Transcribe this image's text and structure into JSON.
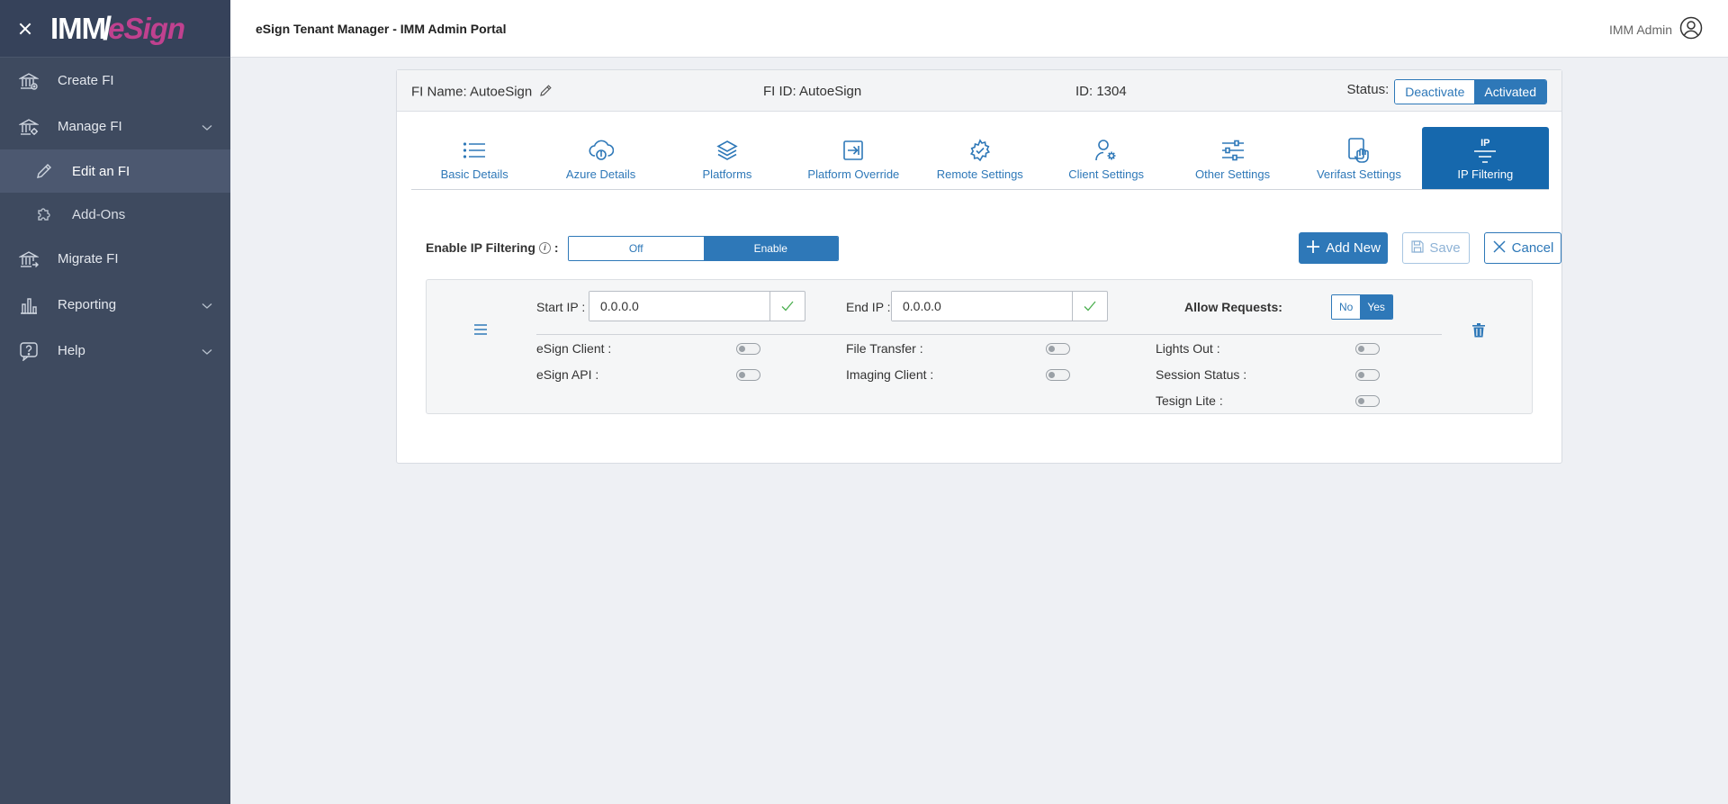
{
  "sidebar": {
    "logo_imm": "IMM",
    "logo_esign": "eSign",
    "items": [
      {
        "label": "Create FI"
      },
      {
        "label": "Manage FI"
      },
      {
        "label": "Edit an FI"
      },
      {
        "label": "Add-Ons"
      },
      {
        "label": "Migrate FI"
      },
      {
        "label": "Reporting"
      },
      {
        "label": "Help"
      }
    ]
  },
  "topbar": {
    "title": "eSign Tenant Manager - IMM Admin Portal",
    "user": "IMM Admin"
  },
  "card": {
    "fi_name": "FI Name: AutoeSign",
    "fi_id": "FI ID: AutoeSign",
    "id": "ID: 1304",
    "status_label": "Status:",
    "status_options": [
      "Deactivate",
      "Activated"
    ],
    "status_selected": "Activated"
  },
  "tabs": [
    {
      "label": "Basic Details",
      "icon": "list-icon"
    },
    {
      "label": "Azure Details",
      "icon": "cloud-icon"
    },
    {
      "label": "Platforms",
      "icon": "layers-icon"
    },
    {
      "label": "Platform Override",
      "icon": "override-icon"
    },
    {
      "label": "Remote Settings",
      "icon": "gear-icon"
    },
    {
      "label": "Client Settings",
      "icon": "user-gear-icon"
    },
    {
      "label": "Other Settings",
      "icon": "sliders-icon"
    },
    {
      "label": "Verifast Settings",
      "icon": "hand-icon"
    },
    {
      "label": "IP Filtering",
      "icon": "ip-filter-icon",
      "icon_text": "IP",
      "active": true
    }
  ],
  "ip_filtering": {
    "label": "Enable IP Filtering",
    "info_glyph": "i",
    "colon": ":",
    "options": [
      "Off",
      "Enable"
    ],
    "selected": "Enable",
    "add_label": "Add New",
    "save_label": "Save",
    "cancel_label": "Cancel"
  },
  "rule": {
    "start_label": "Start IP :",
    "start_value": "0.0.0.0",
    "end_label": "End IP :",
    "end_value": "0.0.0.0",
    "allow_label": "Allow Requests:",
    "allow_options": [
      "No",
      "Yes"
    ],
    "allow_selected": "Yes",
    "services": [
      {
        "label": "eSign Client :",
        "on": false
      },
      {
        "label": "eSign API :",
        "on": false
      },
      {
        "label": "File Transfer :",
        "on": false
      },
      {
        "label": "Imaging Client :",
        "on": false
      },
      {
        "label": "Lights Out :",
        "on": false
      },
      {
        "label": "Session Status :",
        "on": false
      },
      {
        "label": "Tesign Lite :",
        "on": false
      }
    ]
  },
  "colors": {
    "sidebar_bg": "#3e4a5f",
    "accent": "#2e78b8",
    "active_tab": "#1668ad",
    "brand_pink": "#c0418f",
    "check_green": "#4caf50"
  }
}
